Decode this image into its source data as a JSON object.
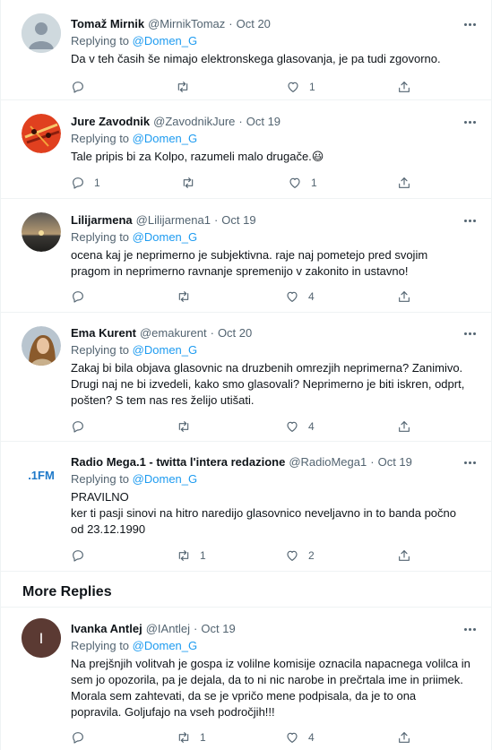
{
  "tweets": [
    {
      "name": "Tomaž Mirnik",
      "handle": "@MirnikTomaz",
      "date": "Oct 20",
      "replying_label": "Replying to",
      "replying_to": "@Domen_G",
      "lines": [
        "Da v teh časih še nimajo elektronskega glasovanja, je pa tudi zgovorno."
      ],
      "replies": "",
      "retweets": "",
      "likes": "1",
      "avatar": "default-avatar-icon"
    },
    {
      "name": "Jure Zavodnik",
      "handle": "@ZavodnikJure",
      "date": "Oct 19",
      "replying_label": "Replying to",
      "replying_to": "@Domen_G",
      "lines": [
        "Tale pripis bi za Kolpo, razumeli malo drugače.😃"
      ],
      "replies": "1",
      "retweets": "",
      "likes": "1",
      "avatar": "red-pattern-avatar"
    },
    {
      "name": "Lilijarmena",
      "handle": "@Lilijarmena1",
      "date": "Oct 19",
      "replying_label": "Replying to",
      "replying_to": "@Domen_G",
      "lines": [
        "ocena kaj je neprimerno je subjektivna. raje naj pometejo pred svojim",
        "pragom in neprimerno ravnanje spremenijo v zakonito in ustavno!"
      ],
      "replies": "",
      "retweets": "",
      "likes": "4",
      "avatar": "sunset-avatar"
    },
    {
      "name": "Ema Kurent",
      "handle": "@emakurent",
      "date": "Oct 20",
      "replying_label": "Replying to",
      "replying_to": "@Domen_G",
      "lines": [
        "Zakaj bi bila objava glasovnic na druzbenih omrezjih neprimerna? Zanimivo.",
        "Drugi naj ne bi izvedeli, kako smo glasovali? Neprimerno je biti iskren, odprt,",
        "pošten? S tem nas res želijo utišati."
      ],
      "replies": "",
      "retweets": "",
      "likes": "4",
      "avatar": "portrait-avatar"
    },
    {
      "name": "Radio Mega.1 - twitta l'intera redazione",
      "handle": "@RadioMega1",
      "date": "Oct 19",
      "replying_label": "Replying to",
      "replying_to": "@Domen_G",
      "lines": [
        "PRAVILNO",
        "ker ti pasji sinovi na hitro naredijo glasovnico neveljavno in to banda počno",
        "od 23.12.1990"
      ],
      "replies": "",
      "retweets": "1",
      "likes": "2",
      "avatar": "radio-logo-avatar",
      "avatar_text": ".1FM"
    },
    {
      "name": "Ivanka Antlej",
      "handle": "@IAntlej",
      "date": "Oct 19",
      "replying_label": "Replying to",
      "replying_to": "@Domen_G",
      "lines": [
        "Na prejšnjih volitvah je gospa iz volilne komisije oznacila napacnega volilca in",
        "sem jo opozorila, pa je dejala, da to ni nic narobe in prečrtala ime in priimek.",
        "Morala sem zahtevati, da se je vpričo mene podpisala, da je to ona",
        "popravila. Goljufajo na vseh področjih!!!"
      ],
      "replies": "",
      "retweets": "1",
      "likes": "4",
      "avatar": "letter-avatar",
      "avatar_text": "I"
    }
  ],
  "section": {
    "more_replies": "More Replies"
  },
  "colors": {
    "accent": "#1d9bf0",
    "muted": "#536471",
    "text": "#0f1419",
    "border": "#eff3f4"
  }
}
